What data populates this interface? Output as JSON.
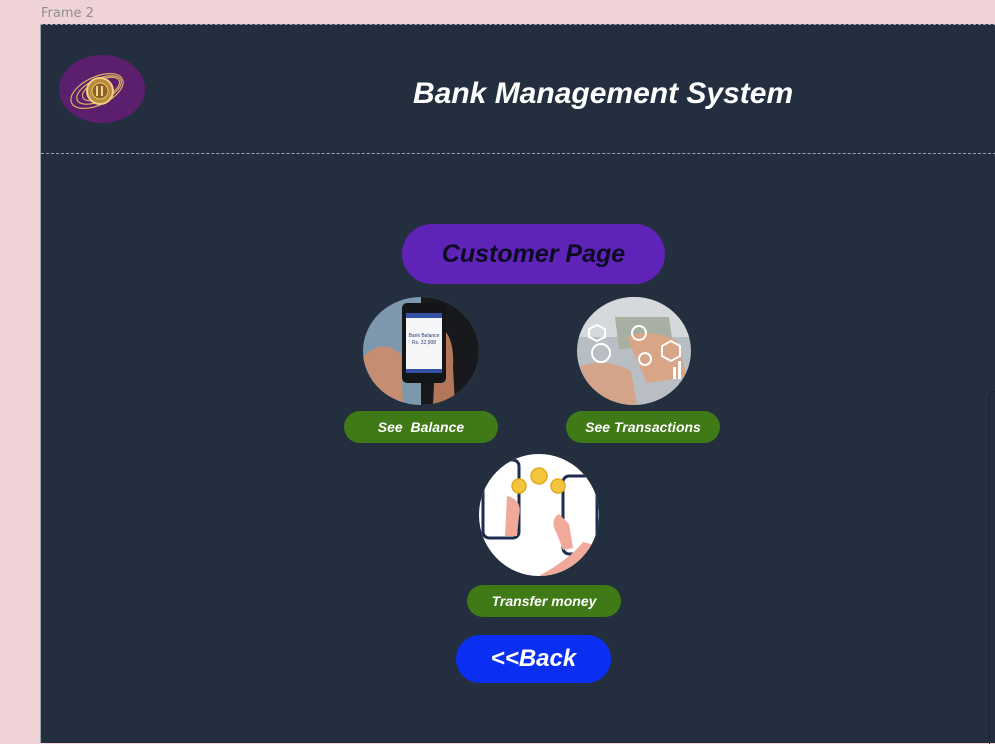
{
  "frame": {
    "label": "Frame 2"
  },
  "header": {
    "title": "Bank Management System",
    "logo_icon": "bank-seal-logo"
  },
  "page": {
    "title": "Customer Page"
  },
  "options": {
    "balance": {
      "label": "See  Balance",
      "icon": "phone-balance-image",
      "screen_title": "Bank Balance",
      "screen_amount": "Rs. 32,908"
    },
    "transactions": {
      "label": "See Transactions",
      "icon": "transactions-image"
    },
    "transfer": {
      "label": "Transfer money",
      "icon": "transfer-money-image"
    }
  },
  "back_button": {
    "label": "<<Back"
  },
  "colors": {
    "canvas": "#efd3d6",
    "frame_bg": "#232f3e",
    "page_title_bg": "#5f23b8",
    "option_pill_bg": "#3f7a16",
    "back_button_bg": "#0b2ff2"
  }
}
